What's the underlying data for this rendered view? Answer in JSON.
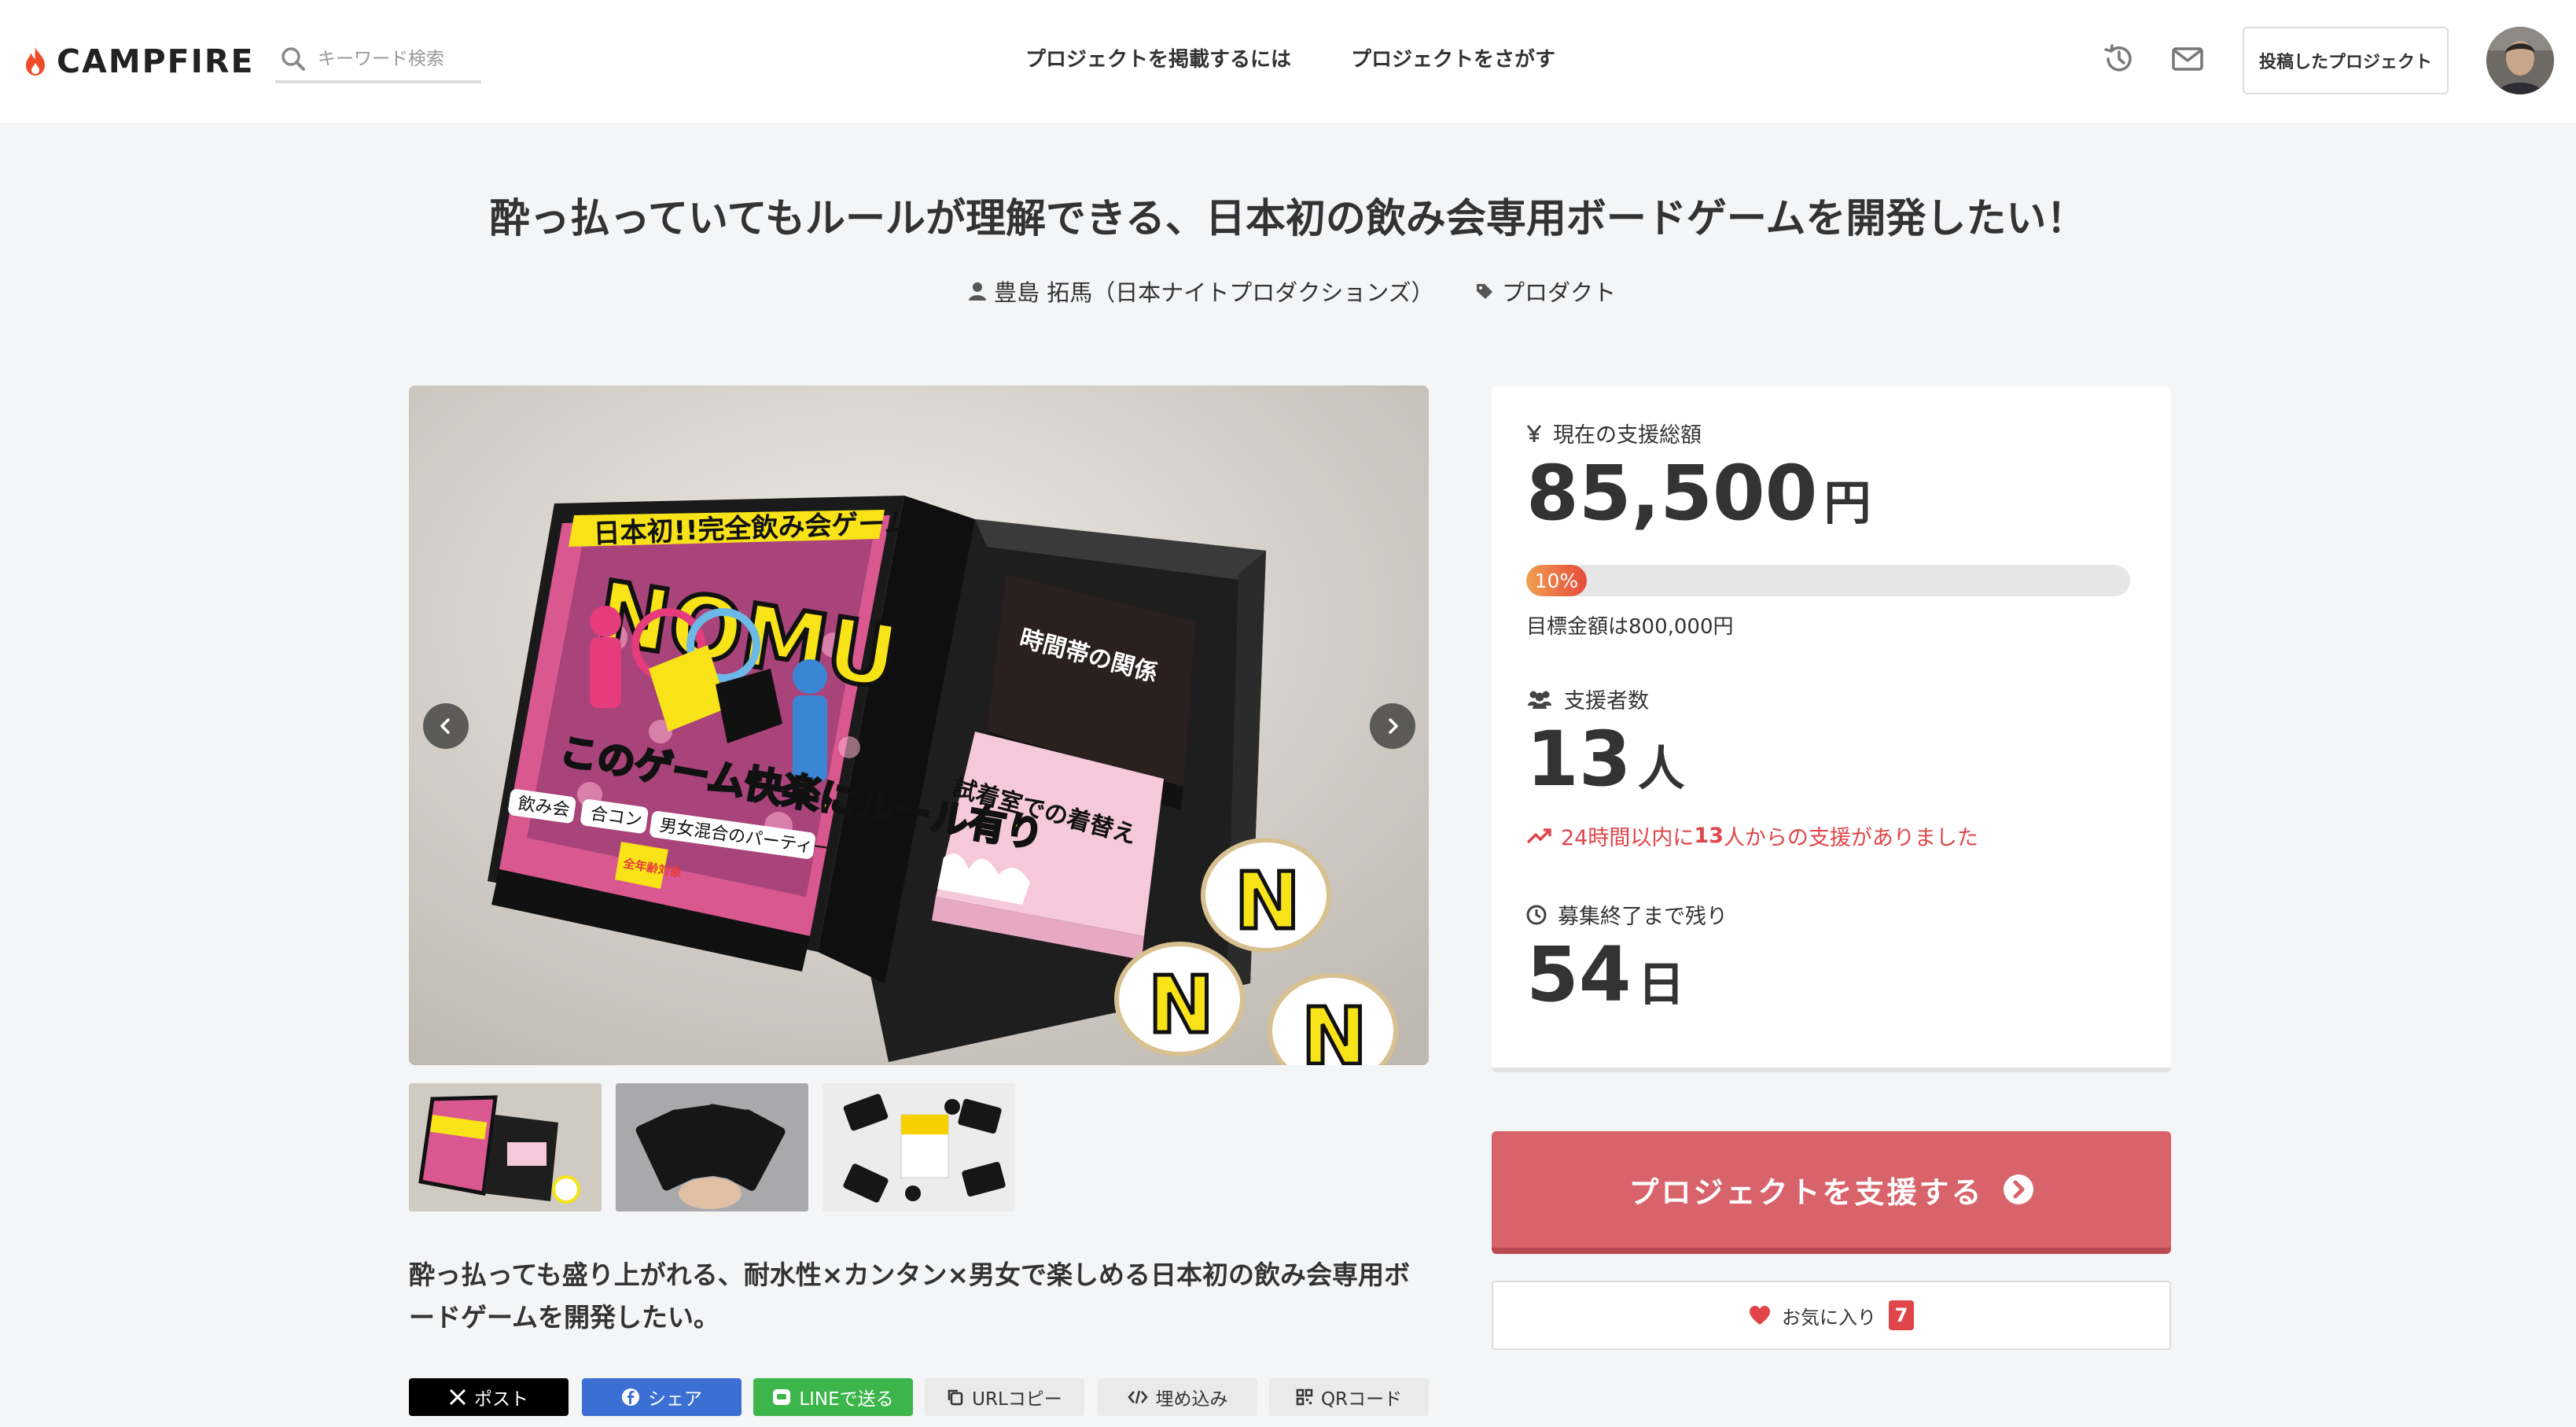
{
  "header": {
    "logo_text": "CAMPFIRE",
    "search_placeholder": "キーワード検索",
    "nav_post": "プロジェクトを掲載するには",
    "nav_search": "プロジェクトをさがす",
    "posted_projects": "投稿したプロジェクト",
    "icons": [
      "history-icon",
      "mail-icon"
    ]
  },
  "project": {
    "title": "酔っ払っていてもルールが理解できる、日本初の飲み会専用ボードゲームを開発したい！",
    "owner": "豊島 拓馬（日本ナイトプロダクションズ）",
    "category": "プロダクト",
    "lead": "酔っ払っても盛り上がれる、耐水性×カンタン×男女で楽しめる日本初の飲み会専用ボードゲームを開発したい。",
    "box_text": {
      "banner": "日本初!!完全飲み会ゲーム",
      "logo": "NOMU",
      "tagline": "このゲーム快楽にルール有り",
      "tags": [
        "飲み会",
        "合コン",
        "男女混合のパーティー"
      ],
      "age": "全年齢対象",
      "card_black": "時間帯の関係",
      "card_pink": "試着室での着替え"
    }
  },
  "stats": {
    "total_label": "現在の支援総額",
    "total_value": "85,500",
    "total_unit": "円",
    "progress_label": "10%",
    "progress_fraction": 0.1,
    "goal": "目標金額は800,000円",
    "backers_label": "支援者数",
    "backers_value": "13",
    "backers_unit": "人",
    "recent_pre": "24時間以内に",
    "recent_count": "13",
    "recent_post": "人からの支援がありました",
    "remaining_label": "募集終了まで残り",
    "remaining_value": "54",
    "remaining_unit": "日"
  },
  "actions": {
    "support": "プロジェクトを支援する",
    "favorite": "お気に入り",
    "favorite_count": "7"
  },
  "share": {
    "x": "ポスト",
    "facebook": "シェア",
    "line": "LINEで送る",
    "url": "URLコピー",
    "embed": "埋め込み",
    "qr": "QRコード"
  },
  "colors": {
    "accent": "#d9636a",
    "alert": "#e0454a",
    "x": "#000000",
    "facebook": "#3b6fd4",
    "line": "#3cb54a"
  }
}
